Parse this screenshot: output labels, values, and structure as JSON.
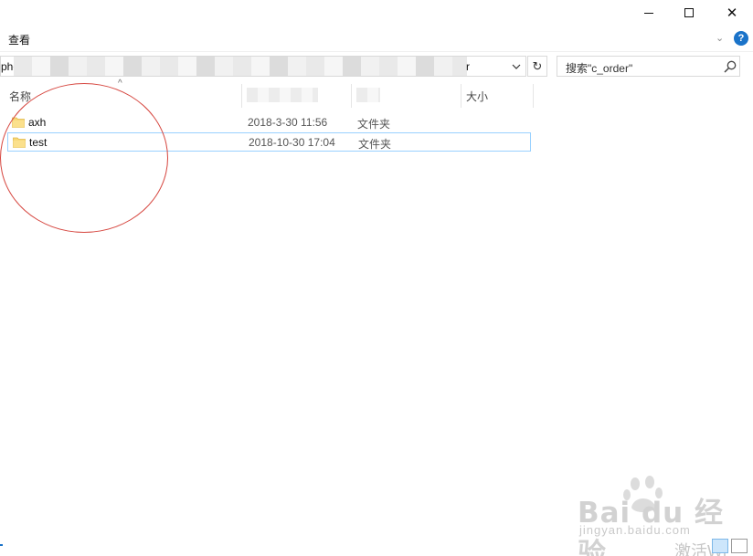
{
  "window": {
    "min_glyph": "—",
    "close_glyph": "✕"
  },
  "ribbon": {
    "view_tab": "查看",
    "expand_glyph": "⌄",
    "help_glyph": "?"
  },
  "address": {
    "prefix": "phc",
    "suffix": "r",
    "dropdown_glyph": "⌵",
    "refresh_glyph": "↻"
  },
  "search": {
    "text": "搜索\"c_order\""
  },
  "columns": {
    "name": "名称",
    "size": "大小",
    "sort_glyph": "^"
  },
  "files": [
    {
      "name": "axh",
      "modified": "2018-3-30 11:56",
      "type": "文件夹"
    },
    {
      "name": "test",
      "modified": "2018-10-30 17:04",
      "type": "文件夹"
    }
  ],
  "watermark": {
    "brand": "Bai du 经验",
    "url": "jingyan.baidu.com"
  },
  "activation_text": "激活Wi",
  "colors": {
    "annotation": "#d6463f",
    "selection_border": "#99d1ff",
    "folder": "#f8d775",
    "help": "#1a73c9"
  },
  "icons": [
    "minimize-icon",
    "maximize-icon",
    "close-icon",
    "help-icon",
    "chevron-down-icon",
    "refresh-icon",
    "search-icon",
    "folder-icon",
    "sort-up-icon"
  ]
}
